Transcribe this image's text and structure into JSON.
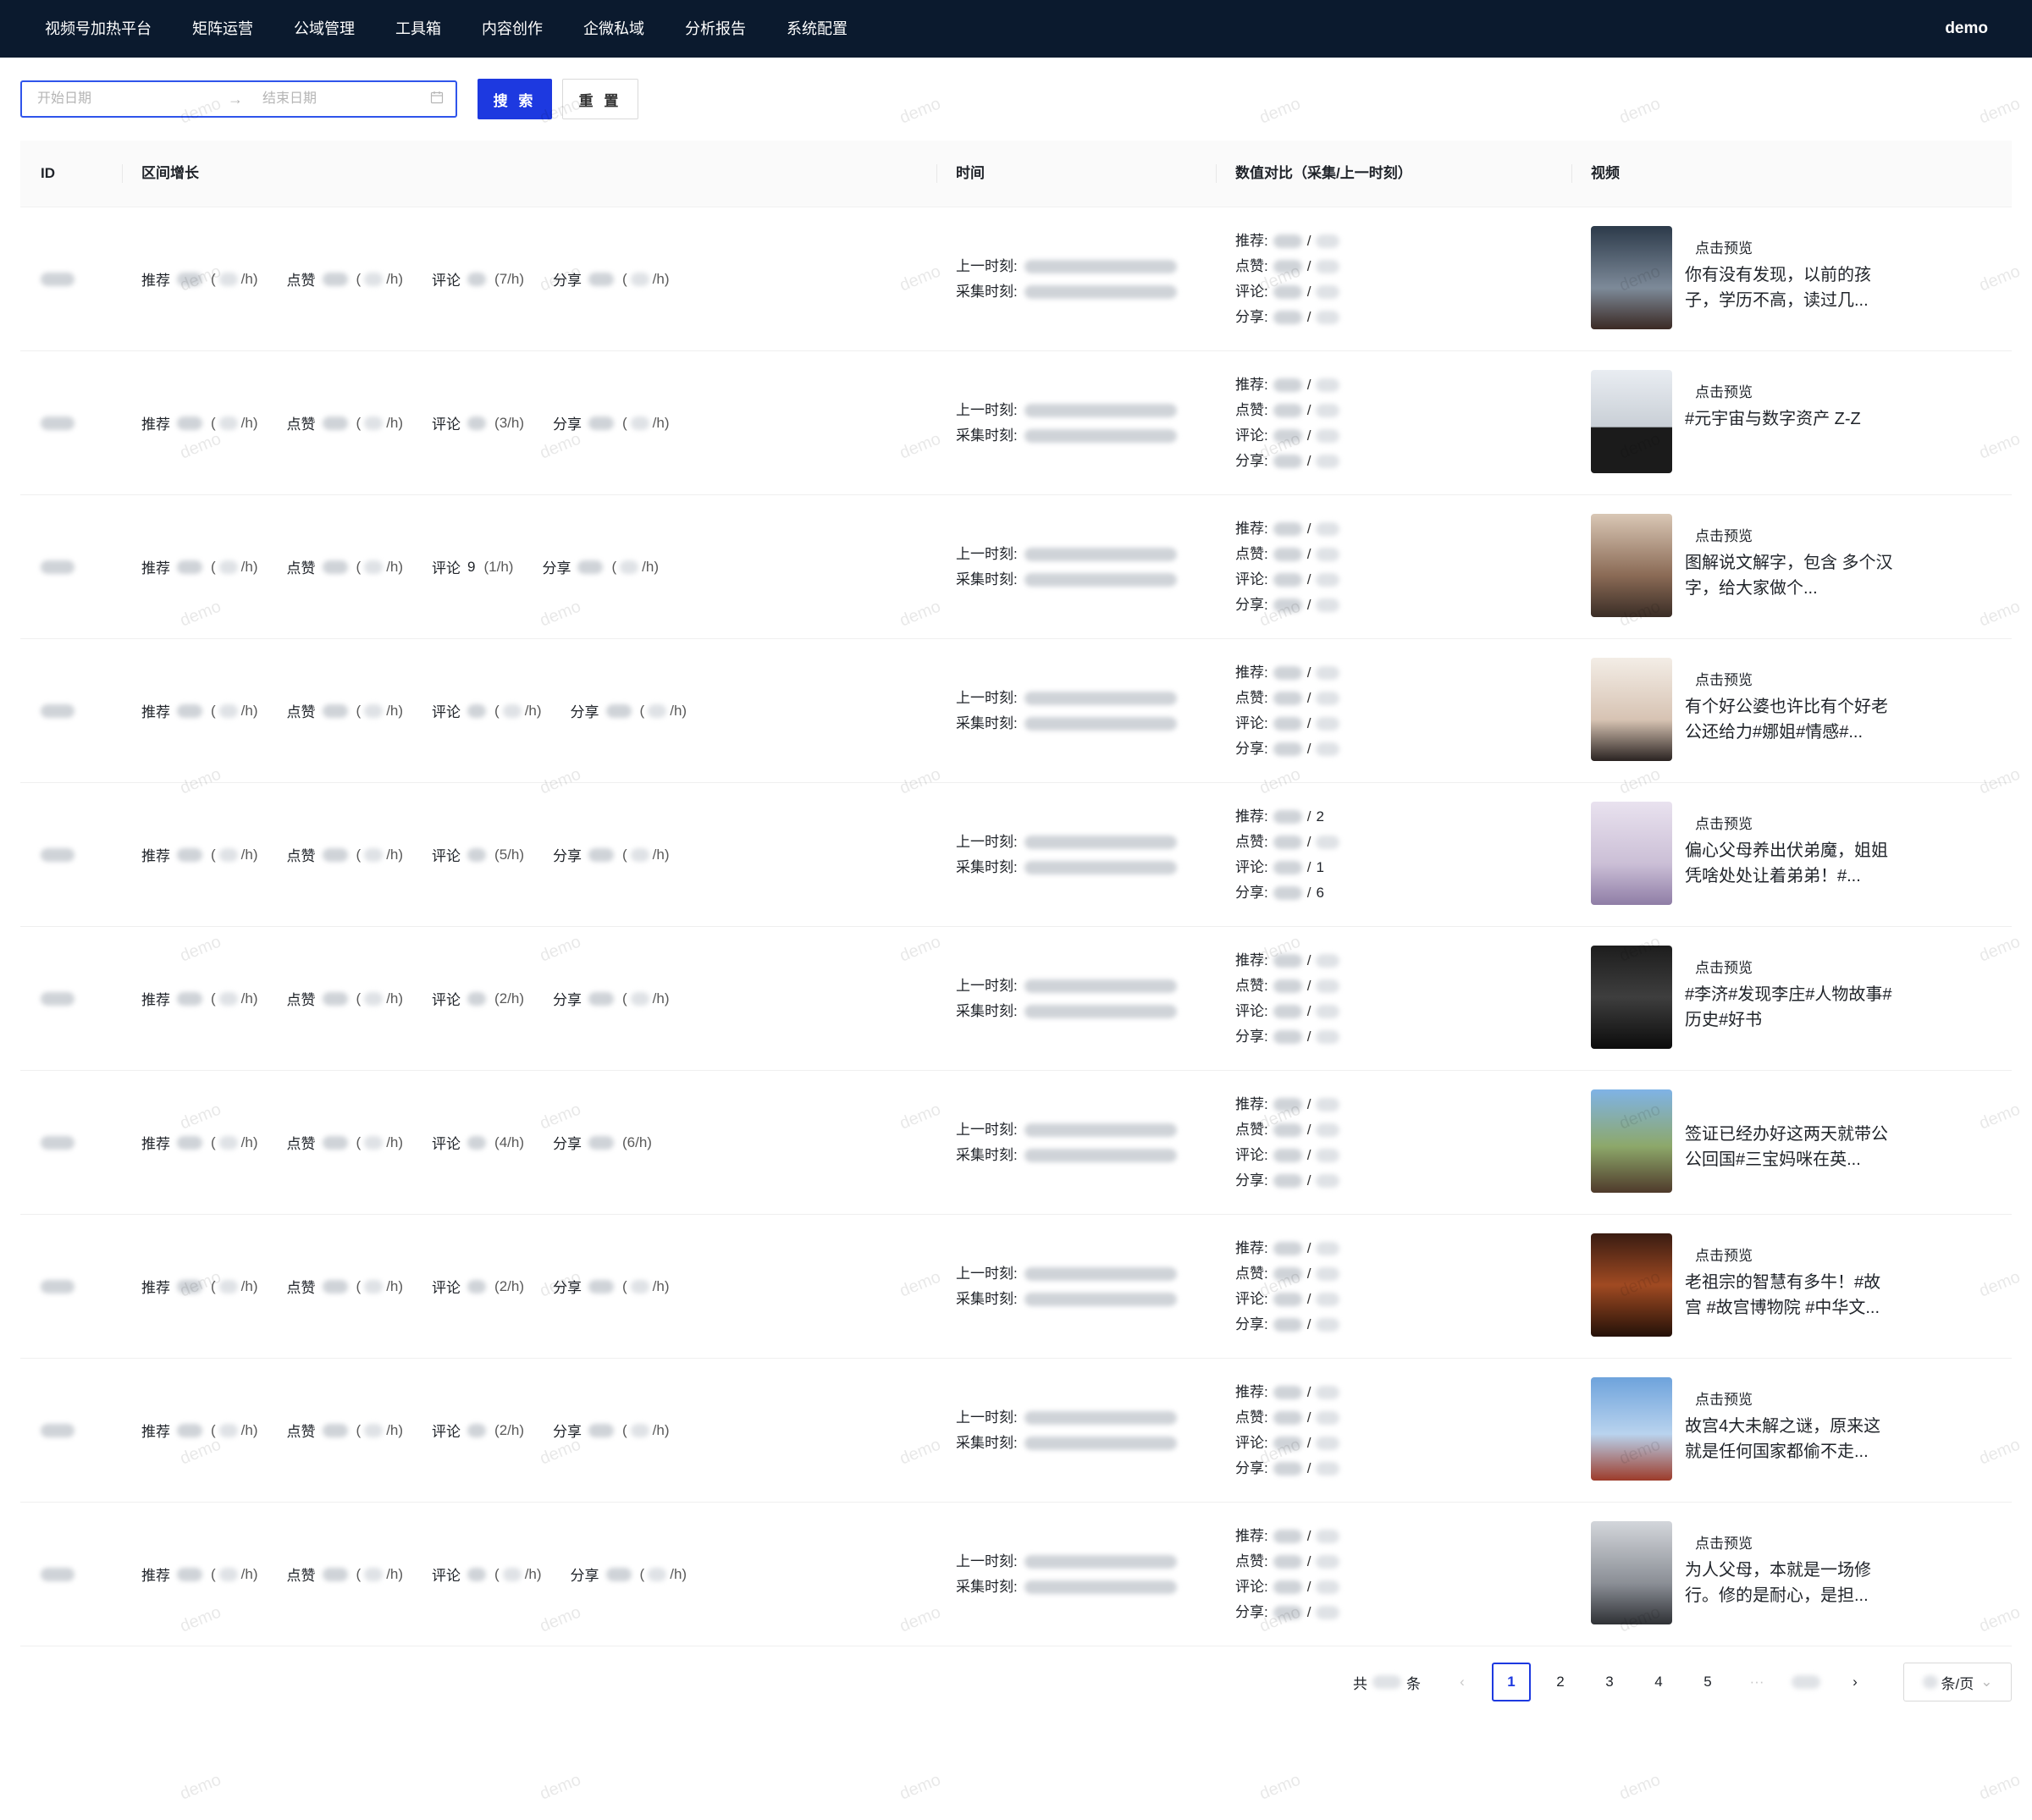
{
  "nav": {
    "items": [
      "视频号加热平台",
      "矩阵运营",
      "公域管理",
      "工具箱",
      "内容创作",
      "企微私域",
      "分析报告",
      "系统配置"
    ],
    "user": "demo"
  },
  "toolbar": {
    "start_placeholder": "开始日期",
    "end_placeholder": "结束日期",
    "search_label": "搜 索",
    "reset_label": "重 置"
  },
  "table": {
    "headers": {
      "id": "ID",
      "growth": "区间增长",
      "time": "时间",
      "compare": "数值对比（采集/上一时刻）",
      "video": "视频"
    },
    "labels": {
      "recommend": "推荐",
      "like": "点赞",
      "comment": "评论",
      "share": "分享",
      "per_hour": "/h)",
      "open_paren": "(",
      "prev_time": "上一时刻:",
      "collect_time": "采集时刻:",
      "cmp_recommend": "推荐:",
      "cmp_like": "点赞:",
      "cmp_comment": "评论:",
      "cmp_share": "分享:",
      "slash": "/",
      "preview": "点击预览"
    },
    "rows": [
      {
        "comment_rate": "(7/h)",
        "comment_val": "",
        "share_rate": "",
        "cmp_suffix": [
          "",
          "",
          "",
          ""
        ],
        "preview": true,
        "title": "你有没有发现，以前的孩子，学历不高，读过几..."
      },
      {
        "comment_rate": "(3/h)",
        "comment_val": "",
        "share_rate": "",
        "cmp_suffix": [
          "",
          "",
          "",
          ""
        ],
        "preview": true,
        "title": "#元宇宙与数字资产 Z-Z"
      },
      {
        "comment_rate": "(1/h)",
        "comment_val": "9",
        "share_rate": "",
        "cmp_suffix": [
          "",
          "",
          "",
          ""
        ],
        "preview": true,
        "title": "图解说文解字，包含 多个汉字，给大家做个..."
      },
      {
        "comment_rate": "",
        "comment_val": "",
        "share_rate": "",
        "cmp_suffix": [
          "",
          "",
          "",
          ""
        ],
        "preview": true,
        "title": "有个好公婆也许比有个好老公还给力#娜姐#情感#..."
      },
      {
        "comment_rate": "(5/h)",
        "comment_val": "",
        "share_rate": "",
        "cmp_suffix": [
          "2",
          "",
          "1",
          "6"
        ],
        "preview": true,
        "title": "偏心父母养出伏弟魔，姐姐凭啥处处让着弟弟！#..."
      },
      {
        "comment_rate": "(2/h)",
        "comment_val": "",
        "share_rate": "",
        "cmp_suffix": [
          "",
          "",
          "",
          ""
        ],
        "preview": true,
        "title": "#李济#发现李庄#人物故事#历史#好书"
      },
      {
        "comment_rate": "(4/h)",
        "comment_val": "",
        "share_rate": "(6/h)",
        "cmp_suffix": [
          "",
          "",
          "",
          ""
        ],
        "preview": false,
        "title": "签证已经办好这两天就带公公回国#三宝妈咪在英..."
      },
      {
        "comment_rate": "(2/h)",
        "comment_val": "",
        "share_rate": "",
        "cmp_suffix": [
          "",
          "",
          "",
          ""
        ],
        "preview": true,
        "title": "老祖宗的智慧有多牛！#故宫 #故宫博物院 #中华文..."
      },
      {
        "comment_rate": "(2/h)",
        "comment_val": "",
        "share_rate": "",
        "cmp_suffix": [
          "",
          "",
          "",
          ""
        ],
        "preview": true,
        "title": "故宫4大未解之谜，原来这就是任何国家都偷不走..."
      },
      {
        "comment_rate": "",
        "comment_val": "",
        "share_rate": "",
        "cmp_suffix": [
          "",
          "",
          "",
          ""
        ],
        "preview": true,
        "title": "为人父母，本就是一场修行。修的是耐心，是担..."
      }
    ]
  },
  "pagination": {
    "total_prefix": "共",
    "total_suffix": "条",
    "pages": [
      "1",
      "2",
      "3",
      "4",
      "5"
    ],
    "ellipsis": "···",
    "prev": "‹",
    "next": "›",
    "size_label": "条/页",
    "size_arrow": "⌄"
  },
  "watermark": "demo",
  "colors": {
    "nav_bg": "#0b1a2e",
    "primary": "#1d39e0"
  }
}
